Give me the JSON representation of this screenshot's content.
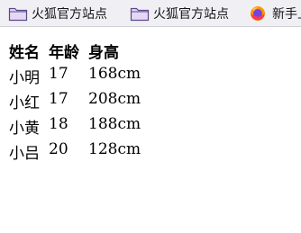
{
  "bookmarks": [
    {
      "label": "火狐官方站点",
      "icon": "folder-icon"
    },
    {
      "label": "火狐官方站点",
      "icon": "folder-icon"
    },
    {
      "label": "新手上路",
      "icon": "firefox-icon"
    }
  ],
  "table": {
    "headers": [
      "姓名",
      "年龄",
      "身高"
    ],
    "rows": [
      [
        "小明",
        "17",
        "168cm"
      ],
      [
        "小红",
        "17",
        "208cm"
      ],
      [
        "小黄",
        "18",
        "188cm"
      ],
      [
        "小吕",
        "20",
        "128cm"
      ]
    ]
  },
  "colors": {
    "toolbar_bg": "#f0f0f4",
    "folder_fill": "#d9c8f0",
    "folder_stroke": "#5b4a8a"
  }
}
